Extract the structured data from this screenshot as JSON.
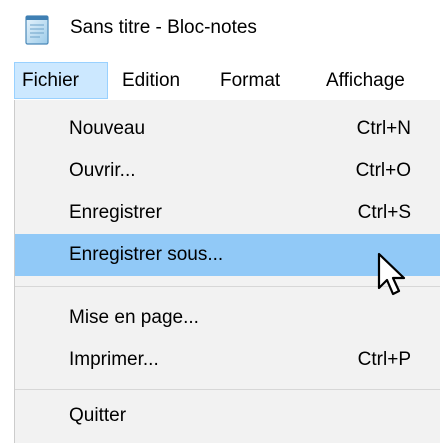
{
  "window": {
    "title": "Sans titre - Bloc-notes",
    "icon": "notepad-icon"
  },
  "menubar": {
    "items": [
      {
        "label": "Fichier",
        "active": true
      },
      {
        "label": "Edition",
        "active": false
      },
      {
        "label": "Format",
        "active": false
      },
      {
        "label": "Affichage",
        "active": false
      }
    ]
  },
  "file_menu": {
    "items": [
      {
        "label": "Nouveau",
        "shortcut": "Ctrl+N"
      },
      {
        "label": "Ouvrir...",
        "shortcut": "Ctrl+O"
      },
      {
        "label": "Enregistrer",
        "shortcut": "Ctrl+S"
      },
      {
        "label": "Enregistrer sous...",
        "shortcut": "",
        "highlighted": true
      },
      {
        "label": "Mise en page...",
        "shortcut": ""
      },
      {
        "label": "Imprimer...",
        "shortcut": "Ctrl+P"
      },
      {
        "label": "Quitter",
        "shortcut": ""
      }
    ]
  },
  "colors": {
    "active_menu_bg": "#cce8ff",
    "active_menu_border": "#99d1ff",
    "highlight_bg": "#91c9f7",
    "dropdown_bg": "#f2f2f2"
  },
  "cursor": {
    "icon": "mouse-pointer-icon"
  }
}
